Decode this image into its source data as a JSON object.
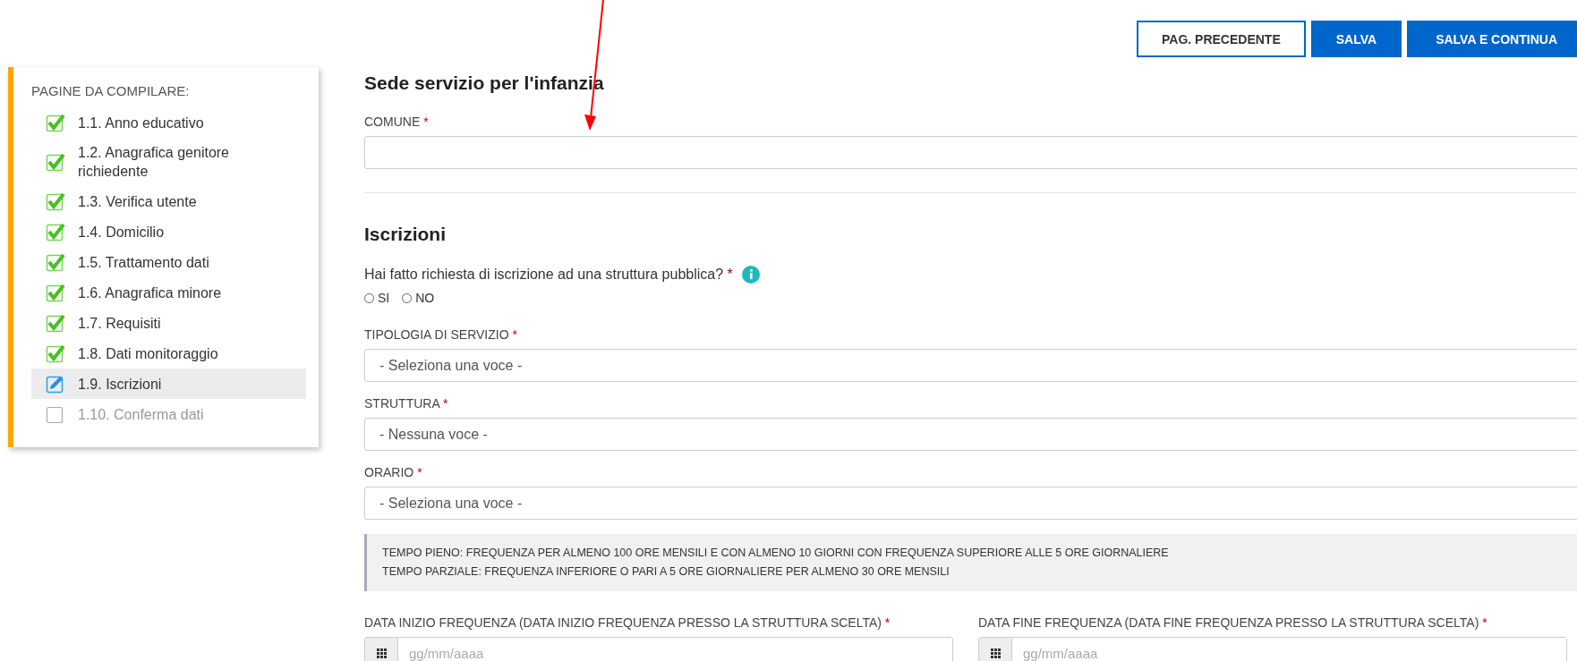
{
  "actions": [
    {
      "label": "PAG. PRECEDENTE",
      "kind": "outline"
    },
    {
      "label": "SALVA",
      "kind": "primary"
    },
    {
      "label": "SALVA E CONTINUA",
      "kind": "primary"
    }
  ],
  "sidebar": {
    "title": "PAGINE DA COMPILARE:",
    "items": [
      {
        "label": "1.1. Anno educativo",
        "kind": "done",
        "selected": false
      },
      {
        "label": "1.2. Anagrafica genitore richiedente",
        "kind": "done",
        "selected": false
      },
      {
        "label": "1.3. Verifica utente",
        "kind": "done",
        "selected": false
      },
      {
        "label": "1.4. Domicilio",
        "kind": "done",
        "selected": false
      },
      {
        "label": "1.5. Trattamento dati",
        "kind": "done",
        "selected": false
      },
      {
        "label": "1.6. Anagrafica minore",
        "kind": "done",
        "selected": false
      },
      {
        "label": "1.7. Requisiti",
        "kind": "done",
        "selected": false
      },
      {
        "label": "1.8. Dati monitoraggio",
        "kind": "done",
        "selected": false
      },
      {
        "label": "1.9. Iscrizioni",
        "kind": "editing",
        "selected": true
      },
      {
        "label": "1.10. Conferma dati",
        "kind": "pending",
        "selected": false
      }
    ]
  },
  "sections": [
    {
      "title": "Sede servizio per l'infanzia",
      "fields": [
        {
          "kind": "text",
          "label": "COMUNE",
          "required": "*"
        }
      ]
    },
    {
      "title": "Iscrizioni",
      "fields": [
        {
          "kind": "radio",
          "label": "Hai fatto richiesta di iscrizione ad una struttura pubblica?",
          "required": "*",
          "info": true,
          "options": [
            {
              "label": "SI",
              "selected": false
            },
            {
              "label": "NO",
              "selected": false
            }
          ]
        },
        {
          "kind": "select",
          "label": "TIPOLOGIA DI SERVIZIO",
          "required": "*",
          "value": "- Seleziona una voce -"
        },
        {
          "kind": "select",
          "label": "STRUTTURA",
          "required": "*",
          "value": "- Nessuna voce -"
        },
        {
          "kind": "select",
          "label": "ORARIO",
          "required": "*",
          "value": "- Seleziona una voce -"
        },
        {
          "kind": "note",
          "lines": [
            "TEMPO PIENO: FREQUENZA PER ALMENO 100 ORE MENSILI E CON ALMENO 10 GIORNI CON FREQUENZA SUPERIORE ALLE 5 ORE GIORNALIERE",
            "TEMPO PARZIALE: FREQUENZA INFERIORE O PARI A 5 ORE GIORNALIERE PER ALMENO 30 ORE MENSILI"
          ]
        },
        {
          "kind": "dates",
          "items": [
            {
              "label": "DATA INIZIO FREQUENZA (DATA INIZIO FREQUENZA PRESSO LA STRUTTURA SCELTA)",
              "required": "*",
              "placeholder": "gg/mm/aaaa"
            },
            {
              "label": "DATA FINE FREQUENZA (DATA FINE FREQUENZA PRESSO LA STRUTTURA SCELTA)",
              "required": "*",
              "placeholder": "gg/mm/aaaa"
            }
          ]
        }
      ]
    }
  ]
}
